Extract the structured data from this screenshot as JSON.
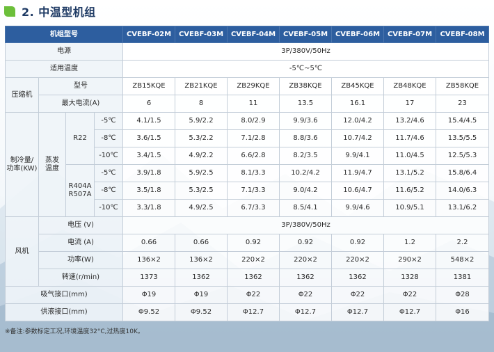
{
  "section_title": "2. 中温型机组",
  "header": {
    "label": "机组型号",
    "models": [
      "CVEBF-02M",
      "CVEBF-03M",
      "CVEBF-04M",
      "CVEBF-05M",
      "CVEBF-06M",
      "CVEBF-07M",
      "CVEBF-08M"
    ]
  },
  "power_supply": {
    "label": "电源",
    "value": "3P/380V/50Hz"
  },
  "temp_range": {
    "label": "适用温度",
    "value": "-5℃~5℃"
  },
  "compressor": {
    "label": "压缩机",
    "model_label": "型号",
    "models": [
      "ZB15KQE",
      "ZB21KQE",
      "ZB29KQE",
      "ZB38KQE",
      "ZB45KQE",
      "ZB48KQE",
      "ZB58KQE"
    ],
    "current_label": "最大电流(A)",
    "currents": [
      "6",
      "8",
      "11",
      "13.5",
      "16.1",
      "17",
      "23"
    ]
  },
  "capacity": {
    "label_line1": "制冷量/",
    "label_line2": "功率(KW)",
    "evap_line1": "蒸发",
    "evap_line2": "温度",
    "r22": {
      "label": "R22",
      "rows": [
        {
          "temp": "-5℃",
          "values": [
            "4.1/1.5",
            "5.9/2.2",
            "8.0/2.9",
            "9.9/3.6",
            "12.0/4.2",
            "13.2/4.6",
            "15.4/4.5"
          ]
        },
        {
          "temp": "-8℃",
          "values": [
            "3.6/1.5",
            "5.3/2.2",
            "7.1/2.8",
            "8.8/3.6",
            "10.7/4.2",
            "11.7/4.6",
            "13.5/5.5"
          ]
        },
        {
          "temp": "-10℃",
          "values": [
            "3.4/1.5",
            "4.9/2.2",
            "6.6/2.8",
            "8.2/3.5",
            "9.9/4.1",
            "11.0/4.5",
            "12.5/5.3"
          ]
        }
      ]
    },
    "r404": {
      "label_line1": "R404A",
      "label_line2": "R507A",
      "rows": [
        {
          "temp": "-5℃",
          "values": [
            "3.9/1.8",
            "5.9/2.5",
            "8.1/3.3",
            "10.2/4.2",
            "11.9/4.7",
            "13.1/5.2",
            "15.8/6.4"
          ]
        },
        {
          "temp": "-8℃",
          "values": [
            "3.5/1.8",
            "5.3/2.5",
            "7.1/3.3",
            "9.0/4.2",
            "10.6/4.7",
            "11.6/5.2",
            "14.0/6.3"
          ]
        },
        {
          "temp": "-10℃",
          "values": [
            "3.3/1.8",
            "4.9/2.5",
            "6.7/3.3",
            "8.5/4.1",
            "9.9/4.6",
            "10.9/5.1",
            "13.1/6.2"
          ]
        }
      ]
    }
  },
  "fan": {
    "label": "风机",
    "voltage_label": "电压 (V)",
    "voltage_value": "3P/380V/50Hz",
    "current_label": "电流 (A)",
    "currents": [
      "0.66",
      "0.66",
      "0.92",
      "0.92",
      "0.92",
      "1.2",
      "2.2"
    ],
    "power_label": "功率(W)",
    "powers": [
      "136×2",
      "136×2",
      "220×2",
      "220×2",
      "220×2",
      "290×2",
      "548×2"
    ],
    "speed_label": "转速(r/min)",
    "speeds": [
      "1373",
      "1362",
      "1362",
      "1362",
      "1362",
      "1328",
      "1381"
    ]
  },
  "suction": {
    "label": "吸气接口(mm)",
    "values": [
      "Φ19",
      "Φ19",
      "Φ22",
      "Φ22",
      "Φ22",
      "Φ22",
      "Φ28"
    ]
  },
  "liquid": {
    "label": "供液接口(mm)",
    "values": [
      "Φ9.52",
      "Φ9.52",
      "Φ12.7",
      "Φ12.7",
      "Φ12.7",
      "Φ12.7",
      "Φ16"
    ]
  },
  "note": "※备注:参数标定工况,环境温度32°C,过热度10K。",
  "colors": {
    "header_bg": "#2d5e9f",
    "title": "#1e3a64",
    "accent": "#6cbf3a",
    "border": "#c3cdd8"
  }
}
